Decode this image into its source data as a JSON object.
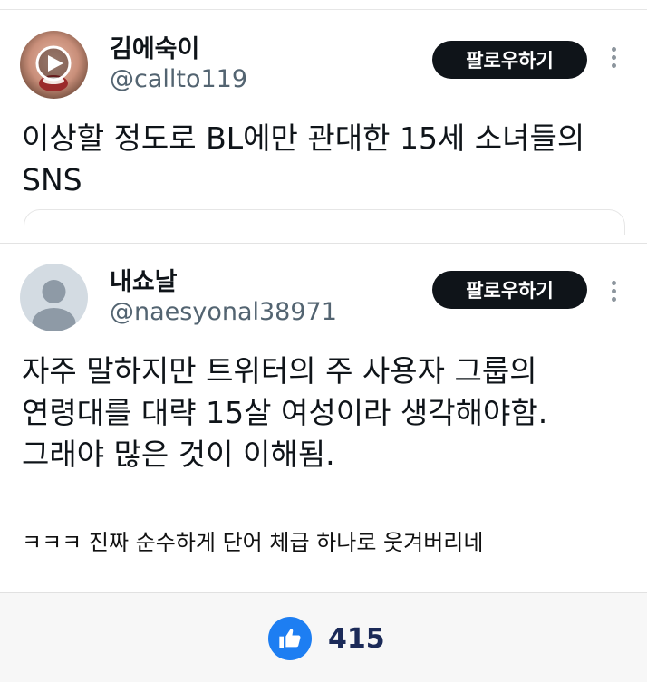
{
  "posts": [
    {
      "name": "김에숙이",
      "handle": "@callto119",
      "follow_label": "팔로우하기",
      "text": "이상할 정도로 BL에만 관대한 15세 소녀들의\nSNS"
    },
    {
      "name": "내쇼날",
      "handle": "@naesyonal38971",
      "follow_label": "팔로우하기",
      "text": "자주 말하지만 트위터의 주 사용자 그룹의\n연령대를 대략 15살 여성이라 생각해야함.\n그래야 많은 것이 이해됨."
    }
  ],
  "comment": "ㅋㅋㅋ 진짜 순수하게 단어 체급 하나로 웃겨버리네",
  "like": {
    "count": "415",
    "icon": "thumbs-up-icon",
    "color": "#1d7ef2"
  },
  "icons": {
    "avatar1": "play-icon",
    "avatar2": "default-avatar-icon",
    "more": "more-vertical-icon"
  }
}
